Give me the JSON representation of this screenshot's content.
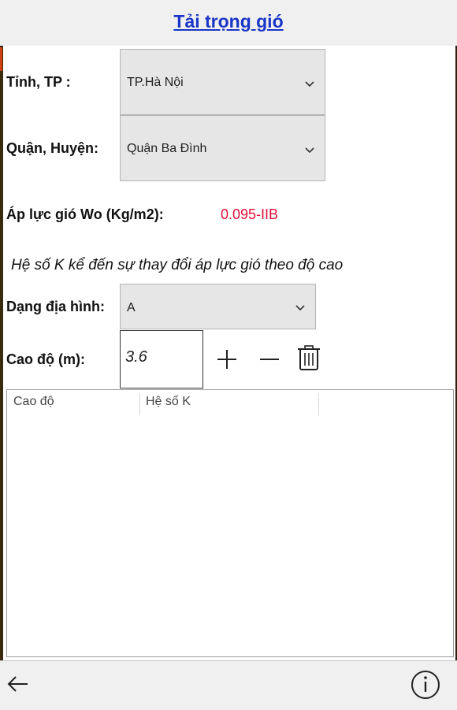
{
  "header": {
    "title": "Tải trọng gió"
  },
  "form": {
    "province_label": "Tỉnh, TP :",
    "province_value": "TP.Hà Nội",
    "district_label": "Quận, Huyện:",
    "district_value": "Quận Ba Đình",
    "wo_label": "Áp lực gió Wo (Kg/m2):",
    "wo_value": "0.095-IIB",
    "k_heading": "Hệ số K kể đến sự thay đổi áp lực gió theo độ cao",
    "terrain_label": "Dạng địa hình:",
    "terrain_value": "A",
    "height_label": "Cao độ (m):",
    "height_value": "3.6"
  },
  "table": {
    "columns": [
      "Cao độ",
      "Hệ số K"
    ],
    "rows": []
  },
  "icons": {
    "add": "plus-icon",
    "remove": "minus-icon",
    "delete": "trash-icon",
    "back": "arrow-left-icon",
    "info": "info-icon"
  },
  "colors": {
    "title": "#1a35c7",
    "wo_value": "#e0103a",
    "select_bg": "#e6e6e6"
  }
}
